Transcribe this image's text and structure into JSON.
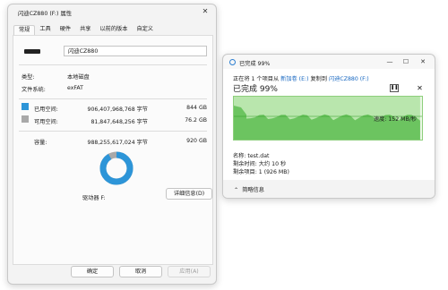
{
  "properties": {
    "title": "闪迪CZ880 (F:) 属性",
    "tabs": [
      "常规",
      "工具",
      "硬件",
      "共享",
      "以前的版本",
      "自定义"
    ],
    "drive_name": "闪迪CZ880",
    "type_label": "类型:",
    "type_value": "本地磁盘",
    "fs_label": "文件系统:",
    "fs_value": "exFAT",
    "used_label": "已用空间:",
    "used_bytes": "906,407,968,768 字节",
    "used_gb": "844 GB",
    "free_label": "可用空间:",
    "free_bytes": "81,847,648,256 字节",
    "free_gb": "76.2 GB",
    "capacity_label": "容量:",
    "capacity_bytes": "988,255,617,024 字节",
    "capacity_gb": "920 GB",
    "drive_letter": "驱动器 F:",
    "details_button": "详细信息(D)",
    "ok_button": "确定",
    "cancel_button": "取消",
    "apply_button": "应用(A)",
    "used_fraction": 0.917,
    "colors": {
      "used": "#2d95d8",
      "free": "#a9a9a9"
    }
  },
  "copy": {
    "title": "已完成 99%",
    "line_prefix": "正在将 1 个项目从 ",
    "source": "新加卷 (E:)",
    "line_mid": " 复制到 ",
    "dest": "闪迪CZ880 (F:)",
    "heading": "已完成 99%",
    "pause_icon": "pause-icon",
    "speed": "速度: 152 MB/秒",
    "name_line": "名称: test.dat",
    "time_line": "剩余时间: 大约 10 秒",
    "items_line": "剩余项目: 1 (926 MB)",
    "details_toggle": "简略信息",
    "progress_percent": 99,
    "speed_mb_per_s": 152,
    "colors": {
      "fill": "#6cc460",
      "bar": "#b9e6ad",
      "line": "#2a9a1e"
    }
  }
}
